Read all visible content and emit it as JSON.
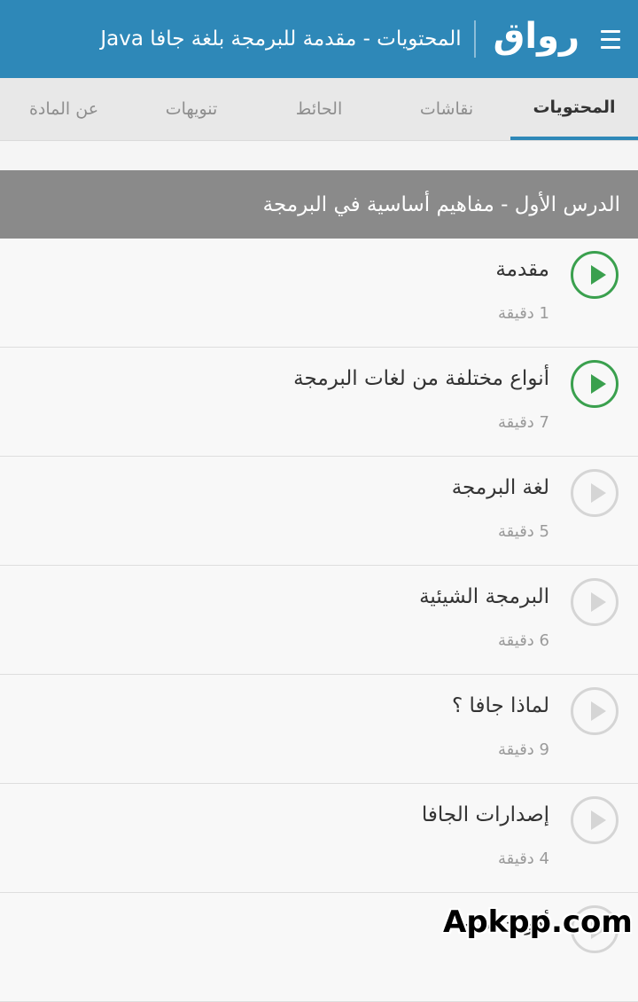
{
  "appbar": {
    "logo": "رواق",
    "title": "المحتويات - مقدمة للبرمجة بلغة جافا Java"
  },
  "tabs": [
    {
      "label": "المحتويات",
      "active": true
    },
    {
      "label": "نقاشات",
      "active": false
    },
    {
      "label": "الحائط",
      "active": false
    },
    {
      "label": "تنويهات",
      "active": false
    },
    {
      "label": "عن المادة",
      "active": false
    }
  ],
  "section": {
    "title": "الدرس الأول - مفاهيم أساسية في البرمجة"
  },
  "items": [
    {
      "title": "مقدمة",
      "duration": "1 دقيقة",
      "watched": true
    },
    {
      "title": "أنواع مختلفة من لغات البرمجة",
      "duration": "7 دقيقة",
      "watched": true
    },
    {
      "title": "لغة البرمجة",
      "duration": "5 دقيقة",
      "watched": false
    },
    {
      "title": "البرمجة الشيئية",
      "duration": "6 دقيقة",
      "watched": false
    },
    {
      "title": "لماذا جافا ؟",
      "duration": "9 دقيقة",
      "watched": false
    },
    {
      "title": "إصدارات الجافا",
      "duration": "4 دقيقة",
      "watched": false
    },
    {
      "title": "أدوات لازمة",
      "duration": "",
      "watched": false
    }
  ],
  "watermark": "Apkpp.com",
  "colors": {
    "primary": "#2e88b8",
    "watched": "#3aa04e",
    "section": "#8a8a8a"
  }
}
